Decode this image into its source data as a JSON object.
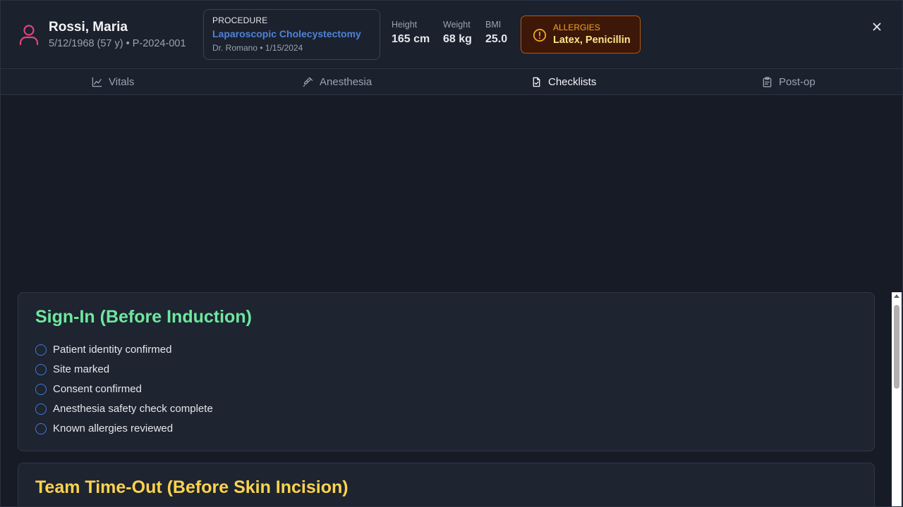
{
  "patient": {
    "name": "Rossi, Maria",
    "subtitle": "5/12/1968 (57 y) • P-2024-001",
    "icon": "user-icon",
    "accent": "#e0457b"
  },
  "procedure": {
    "label": "PROCEDURE",
    "name": "Laparoscopic Cholecystectomy",
    "meta": "Dr. Romano • 1/15/2024"
  },
  "stats": {
    "height_label": "Height",
    "height_value": "165 cm",
    "weight_label": "Weight",
    "weight_value": "68 kg",
    "bmi_label": "BMI",
    "bmi_value": "25.0"
  },
  "allergies": {
    "label": "ALLERGIES",
    "value": "Latex, Penicillin",
    "icon": "alert-circle-icon"
  },
  "close_icon": "close-icon",
  "tabs": [
    {
      "label": "Vitals",
      "icon": "chart-line-icon",
      "active": false
    },
    {
      "label": "Anesthesia",
      "icon": "syringe-icon",
      "active": false
    },
    {
      "label": "Checklists",
      "icon": "file-check-icon",
      "active": true
    },
    {
      "label": "Post-op",
      "icon": "clipboard-icon",
      "active": false
    }
  ],
  "sign_in": {
    "title": "Sign-In (Before Induction)",
    "color": "#6ee7a0",
    "items": [
      {
        "label": "Patient identity confirmed",
        "checked": false
      },
      {
        "label": "Site marked",
        "checked": false
      },
      {
        "label": "Consent confirmed",
        "checked": false
      },
      {
        "label": "Anesthesia safety check complete",
        "checked": false
      },
      {
        "label": "Known allergies reviewed",
        "checked": false
      }
    ]
  },
  "time_out": {
    "title": "Team Time-Out (Before Skin Incision)",
    "color": "#fcd34d"
  }
}
